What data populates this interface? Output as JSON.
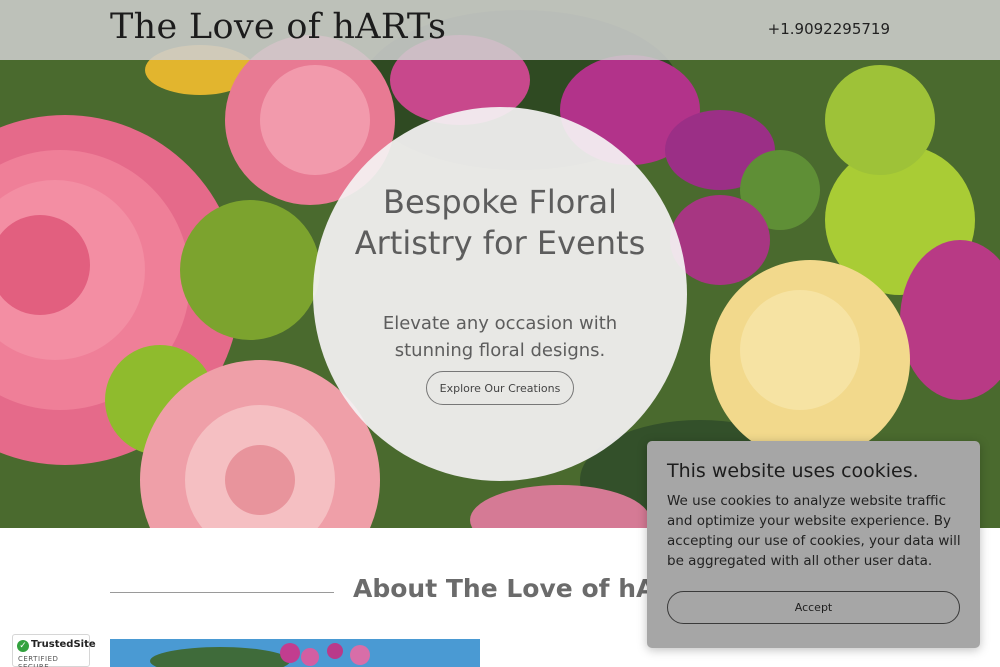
{
  "header": {
    "logo": "The Love of hARTs",
    "phone": "+1.9092295719"
  },
  "hero": {
    "title": "Bespoke Floral Artistry for Events",
    "subtitle": "Elevate any occasion with stunning floral designs.",
    "cta_label": "Explore Our Creations"
  },
  "about": {
    "title": "About The Love of hARTs"
  },
  "trust_badge": {
    "name": "TrustedSite",
    "subtitle": "CERTIFIED SECURE"
  },
  "cookie_banner": {
    "title": "This website uses cookies.",
    "text": "We use cookies to analyze website traffic and optimize your website experience. By accepting our use of cookies, your data will be aggregated with all other user data.",
    "accept_label": "Accept"
  }
}
